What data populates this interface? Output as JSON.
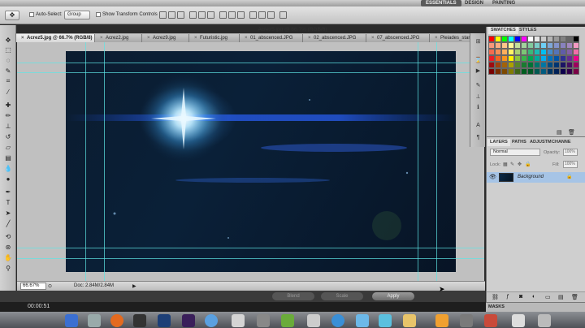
{
  "workspace": {
    "buttons": [
      "ESSENTIALS",
      "DESIGN",
      "PAINTING"
    ]
  },
  "options_bar": {
    "auto_select_label": "Auto-Select:",
    "auto_select_value": "Group",
    "show_transform_label": "Show Transform Controls"
  },
  "document": {
    "window_title": "Acrez5.jpg @ 66.7% (RGB/8)",
    "tabs": [
      {
        "label": "Acrez5.jpg @ 66.7% (RGB/8)",
        "active": true
      },
      {
        "label": "Acrez2.jpg",
        "active": false
      },
      {
        "label": "Acrez9.jpg",
        "active": false
      },
      {
        "label": "Futuristic.jpg",
        "active": false
      },
      {
        "label": "01_abscenced.JPG",
        "active": false
      },
      {
        "label": "02_abscenced.JPG",
        "active": false
      },
      {
        "label": "07_abscenced.JPG",
        "active": false
      },
      {
        "label": "Pleiades_star_clu",
        "active": false
      }
    ]
  },
  "status": {
    "zoom": "66.67%",
    "doc_size": "Doc: 2.84M/2.84M"
  },
  "video_controls": {
    "blend_label": "Blend",
    "scale_label": "Scale",
    "apply_label": "Apply",
    "timecode": "00:00:51"
  },
  "swatches_panel": {
    "tabs": [
      "SWATCHES",
      "STYLES"
    ],
    "colors": [
      "#ff0000",
      "#ffff00",
      "#00ff00",
      "#00ffff",
      "#0000ff",
      "#ff00ff",
      "#ffffff",
      "#e6e6e6",
      "#cccccc",
      "#b3b3b3",
      "#999999",
      "#808080",
      "#666666",
      "#000000",
      "#f7977a",
      "#f9ad81",
      "#fdc68a",
      "#fff79a",
      "#c4df9b",
      "#a2d39c",
      "#82ca9d",
      "#7bcdc8",
      "#6ecff6",
      "#7ea7d8",
      "#8493ca",
      "#8882be",
      "#a187be",
      "#f49ac2",
      "#f26c4f",
      "#f68e55",
      "#fbaf5c",
      "#fff467",
      "#acd372",
      "#7cc576",
      "#3bb878",
      "#1abbb4",
      "#00bff3",
      "#438ccb",
      "#5574b9",
      "#605ca8",
      "#855fa8",
      "#f06ea9",
      "#ed1c24",
      "#f26522",
      "#f7941d",
      "#fff200",
      "#8dc63f",
      "#39b54a",
      "#00a651",
      "#00a99d",
      "#00aeef",
      "#0072bc",
      "#0054a6",
      "#2e3192",
      "#662d91",
      "#ec008c",
      "#9e0b0f",
      "#a0410d",
      "#a36209",
      "#aba000",
      "#598527",
      "#1a7b30",
      "#007236",
      "#00746b",
      "#0076a3",
      "#004b80",
      "#003471",
      "#1b1464",
      "#440e62",
      "#9e005d",
      "#790000",
      "#7b2e00",
      "#7d4900",
      "#827b00",
      "#406618",
      "#005e20",
      "#005826",
      "#005952",
      "#005b7f",
      "#003663",
      "#002157",
      "#0d004c",
      "#32004b",
      "#7b0046"
    ]
  },
  "layers_panel": {
    "tabs": [
      "LAYERS",
      "PATHS",
      "ADJUSTM",
      "CHANNE"
    ],
    "blend_mode": "Normal",
    "opacity_label": "Opacity:",
    "opacity_value": "100%",
    "lock_label": "Lock:",
    "fill_label": "Fill:",
    "fill_value": "100%",
    "layers": [
      {
        "name": "Background",
        "selected": true
      }
    ]
  },
  "masks_panel": {
    "title": "MASKS"
  }
}
